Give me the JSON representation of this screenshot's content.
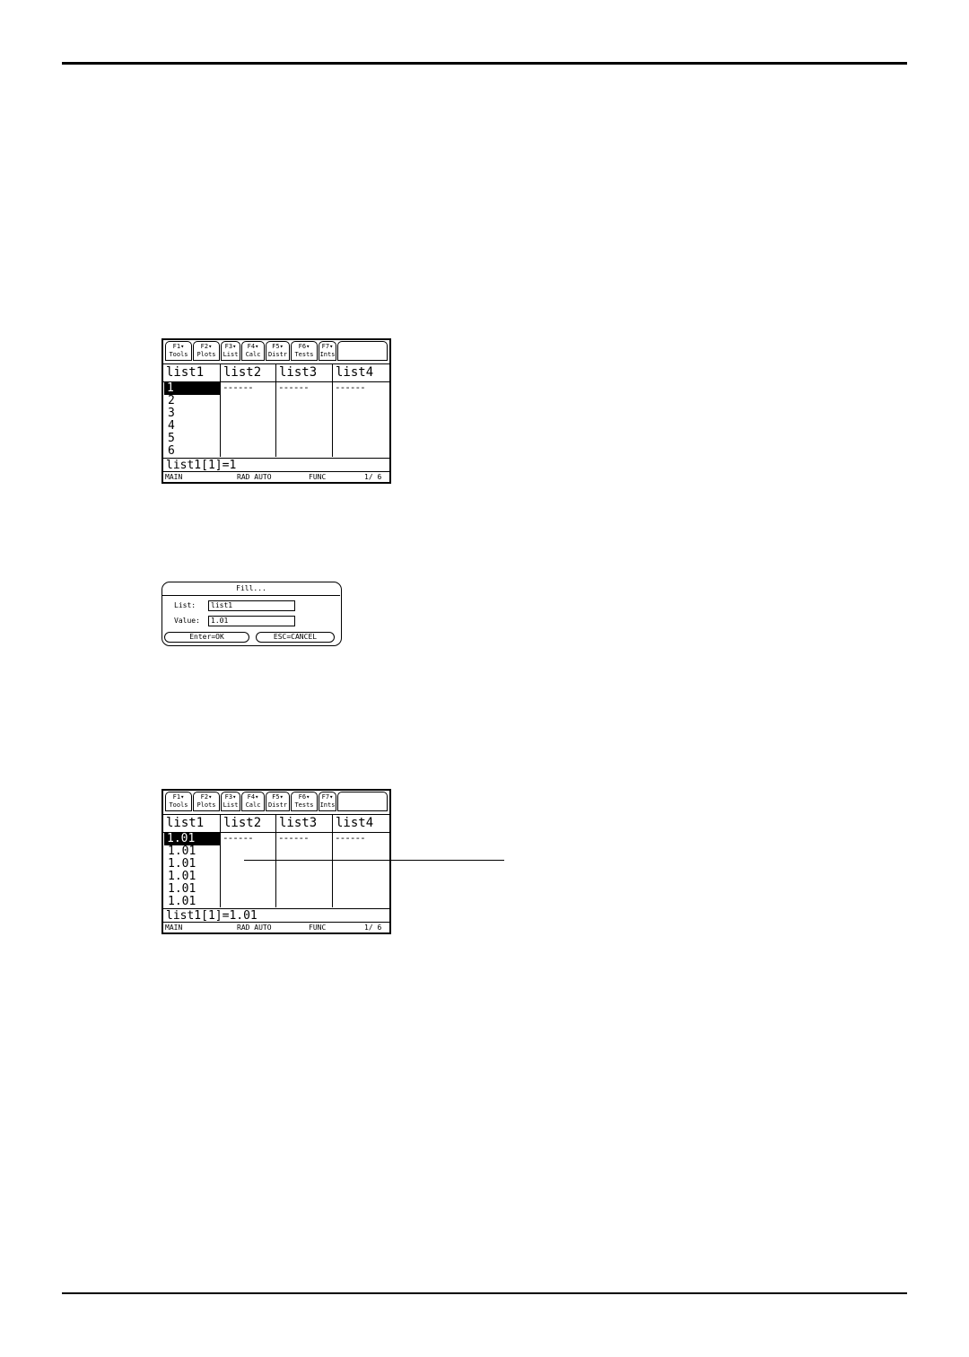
{
  "toolbar": {
    "keys": [
      {
        "key": "F1▾",
        "label": "Tools"
      },
      {
        "key": "F2▾",
        "label": "Plots"
      },
      {
        "key": "F3▾",
        "label": "List"
      },
      {
        "key": "F4▾",
        "label": "Calc"
      },
      {
        "key": "F5▾",
        "label": "Distr"
      },
      {
        "key": "F6▾",
        "label": "Tests"
      },
      {
        "key": "F7▾",
        "label": "Ints"
      }
    ]
  },
  "columns": [
    "list1",
    "list2",
    "list3",
    "list4"
  ],
  "empty_marker": "------",
  "screen1": {
    "list1": [
      "1",
      "2",
      "3",
      "4",
      "5",
      "6"
    ],
    "entry": "list1[1]=1"
  },
  "screen2": {
    "list1": [
      "1.01",
      "1.01",
      "1.01",
      "1.01",
      "1.01",
      "1.01"
    ],
    "entry": "list1[1]=1.01"
  },
  "status": {
    "folder": "MAIN",
    "mode": "RAD AUTO",
    "graph": "FUNC",
    "count": "1/ 6"
  },
  "dialog": {
    "title": "Fill...",
    "list_label": "List:",
    "list_value": "list1",
    "value_label": "Value:",
    "value_value": "1.01",
    "ok_label": "Enter=OK",
    "cancel_label": "ESC=CANCEL"
  }
}
